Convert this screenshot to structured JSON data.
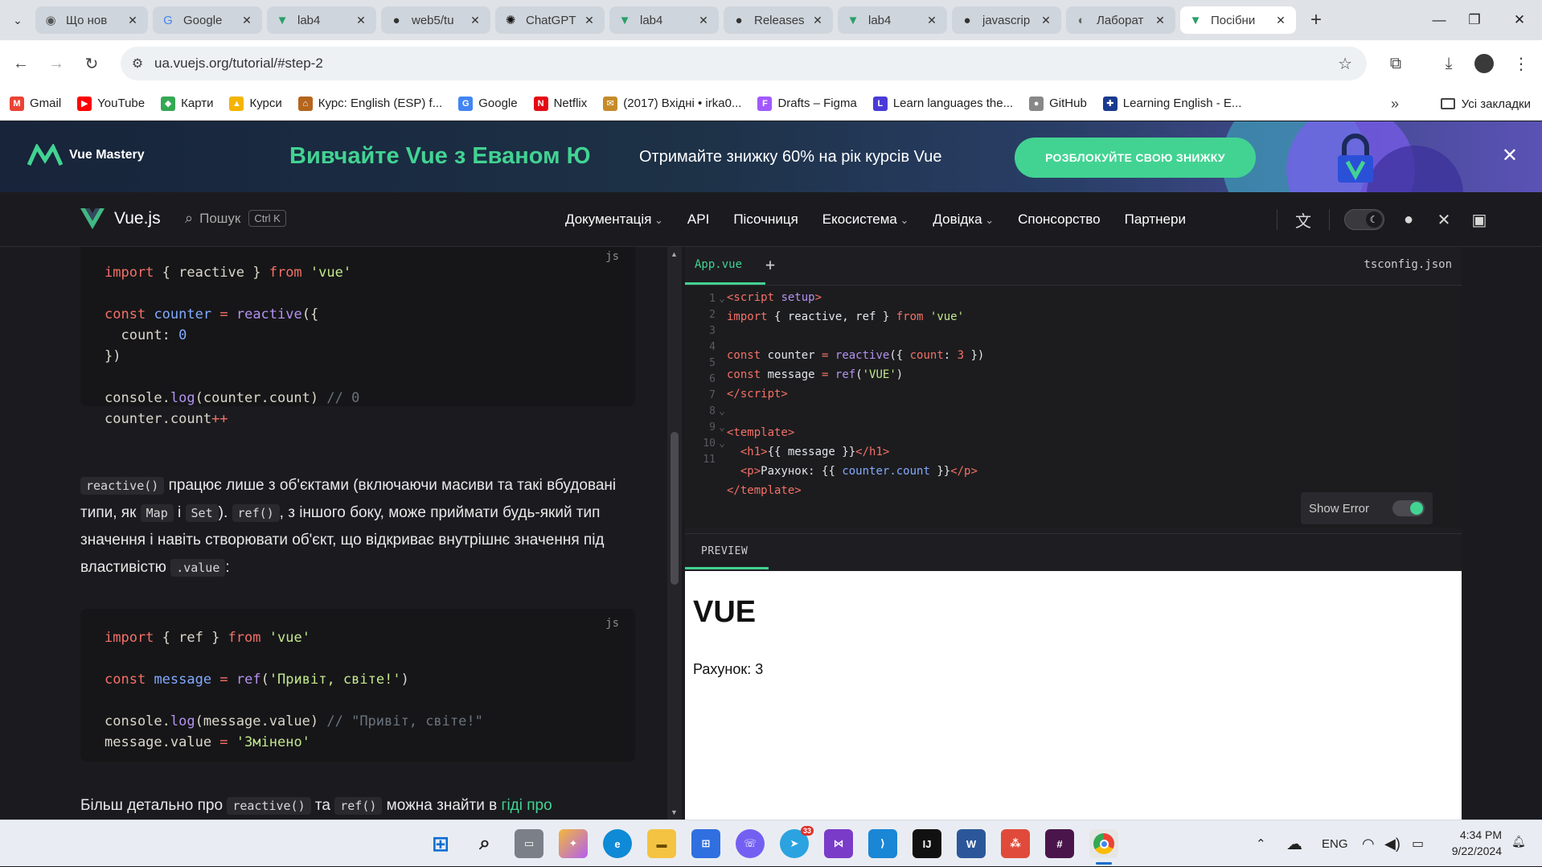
{
  "browser": {
    "tabs": [
      {
        "title": "Що нов",
        "icon": "chrome-icon"
      },
      {
        "title": "Google",
        "icon": "google-icon"
      },
      {
        "title": "lab4",
        "icon": "vue-icon"
      },
      {
        "title": "web5/tu",
        "icon": "github-icon"
      },
      {
        "title": "ChatGPT",
        "icon": "chatgpt-icon"
      },
      {
        "title": "lab4",
        "icon": "vue-icon"
      },
      {
        "title": "Releases",
        "icon": "github-icon"
      },
      {
        "title": "lab4",
        "icon": "vue-icon"
      },
      {
        "title": "javascrip",
        "icon": "github-icon"
      },
      {
        "title": "Лаборат",
        "icon": "globe-icon"
      },
      {
        "title": "Посібни",
        "icon": "vue-icon",
        "active": true
      }
    ],
    "url": "ua.vuejs.org/tutorial/#step-2",
    "bookmarks": [
      {
        "label": "Gmail",
        "color": "#ea4335",
        "glyph": "M"
      },
      {
        "label": "YouTube",
        "color": "#ff0000",
        "glyph": "▶"
      },
      {
        "label": "Карти",
        "color": "#34a853",
        "glyph": "◆"
      },
      {
        "label": "Курси",
        "color": "#f4b400",
        "glyph": "▲"
      },
      {
        "label": "Курс: English (ESP) f...",
        "color": "#b5651d",
        "glyph": "⌂"
      },
      {
        "label": "Google",
        "color": "#4285f4",
        "glyph": "G"
      },
      {
        "label": "Netflix",
        "color": "#e50914",
        "glyph": "N"
      },
      {
        "label": "(2017) Вхідні • irka0...",
        "color": "#c58b2a",
        "glyph": "✉"
      },
      {
        "label": "Drafts – Figma",
        "color": "#a259ff",
        "glyph": "F"
      },
      {
        "label": "Learn languages the...",
        "color": "#4a3ad8",
        "glyph": "L"
      },
      {
        "label": "GitHub",
        "color": "#888888",
        "glyph": "●"
      },
      {
        "label": "Learning English - E...",
        "color": "#1a3a8f",
        "glyph": "✚"
      }
    ],
    "bookmarks_more": "»",
    "all_bookmarks": "Усі закладки"
  },
  "promo": {
    "brand": "Vue Mastery",
    "headline": "Вивчайте Vue з Еваном Ю",
    "subtext": "Отримайте знижку 60% на рік курсів Vue",
    "cta": "РОЗБЛОКУЙТЕ СВОЮ ЗНИЖКУ",
    "close": "✕"
  },
  "nav": {
    "logo": "Vue.js",
    "search_label": "Пошук",
    "search_kbd": "Ctrl K",
    "links": [
      "Документація",
      "API",
      "Пісочниця",
      "Екосистема",
      "Довідка",
      "Спонсорство",
      "Партнери"
    ],
    "dropdown_links": [
      0,
      3,
      4
    ]
  },
  "doc": {
    "code1_lang": "js",
    "code2_lang": "js",
    "para1": {
      "t1": "reactive()",
      "t2": " працює лише з об'єктами (включаючи масиви та такі вбудовані типи, як ",
      "t3": "Map",
      "t4": " і ",
      "t5": "Set",
      "t6": "). ",
      "t7": "ref()",
      "t8": ", з іншого боку, може приймати будь-який тип значення і навіть створювати об'єкт, що відкриває внутрішнє значення під властивістю ",
      "t9": ".value",
      "t10": ":"
    },
    "para2": {
      "t1": "Більш детально про ",
      "t2": "reactive()",
      "t3": " та ",
      "t4": "ref()",
      "t5": " можна знайти в ",
      "t6": "гіді про"
    }
  },
  "repl": {
    "file_tab": "App.vue",
    "add_tab": "+",
    "tsconfig": "tsconfig.json",
    "line_numbers": [
      "1",
      "2",
      "3",
      "4",
      "5",
      "6",
      "7",
      "8",
      "9",
      "10",
      "11"
    ],
    "show_error": "Show Error",
    "preview_tab": "PREVIEW",
    "preview_h1": "VUE",
    "preview_p": "Рахунок: 3"
  },
  "taskbar": {
    "lang": "ENG",
    "time": "4:34 PM",
    "date": "9/22/2024",
    "telegram_badge": "33"
  }
}
